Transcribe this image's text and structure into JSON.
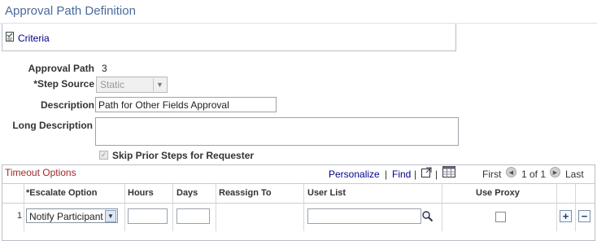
{
  "page": {
    "title": "Approval Path Definition"
  },
  "criteria": {
    "label": "Criteria",
    "icon": "criteria-doc-icon"
  },
  "form": {
    "approval_path_label": "Approval Path",
    "approval_path_value": "3",
    "step_source_label": "*Step Source",
    "step_source_value": "Static",
    "description_label": "Description",
    "description_value": "Path for Other Fields Approval",
    "long_description_label": "Long Description",
    "long_description_value": "",
    "skip_prior_steps_label": "Skip Prior Steps for Requester",
    "skip_prior_steps_checked": true
  },
  "grid": {
    "title": "Timeout Options",
    "personalize": "Personalize",
    "separator": "|",
    "find": "Find",
    "first": "First",
    "range": "1 of 1",
    "last": "Last",
    "columns": {
      "escalate_option": "*Escalate Option",
      "hours": "Hours",
      "days": "Days",
      "reassign_to": "Reassign To",
      "user_list": "User List",
      "use_proxy": "Use Proxy"
    },
    "rows": [
      {
        "row_number": "1",
        "escalate_option": "Notify Participant",
        "hours": "",
        "days": "",
        "reassign_to": "",
        "user_list": "",
        "use_proxy": false
      }
    ]
  }
}
